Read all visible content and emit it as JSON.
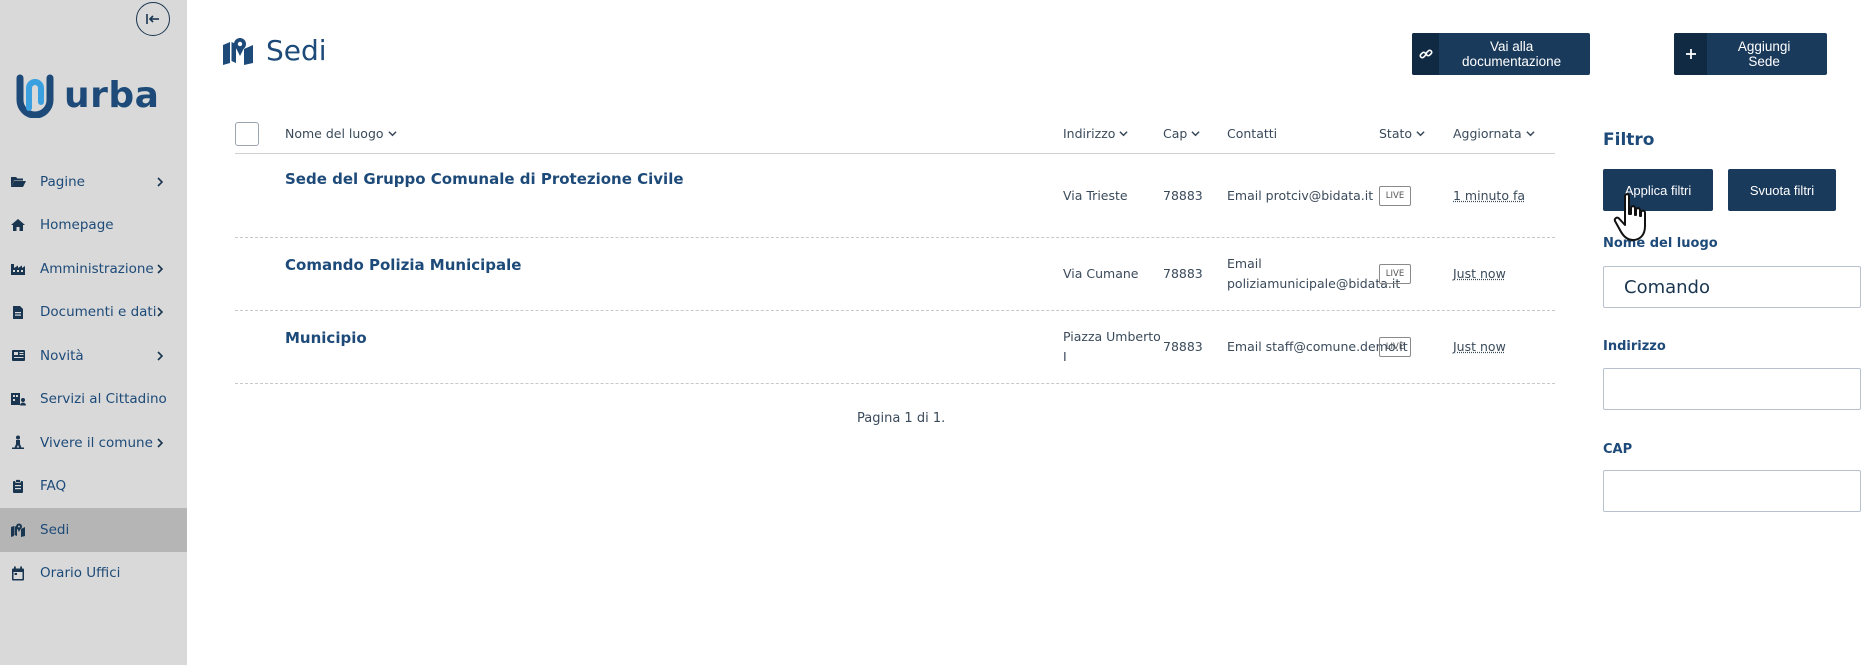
{
  "app": {
    "logo_text": "urba",
    "brand_color": "#1d4a78",
    "sidebar_color": "#d9d9d9",
    "active_item_color": "#b5b5b5",
    "button_color": "#1a3a5c"
  },
  "sidebar": {
    "items": [
      {
        "label": "Pagine",
        "icon": "folder-open-icon",
        "has_submenu": true
      },
      {
        "label": "Homepage",
        "icon": "home-icon",
        "has_submenu": false
      },
      {
        "label": "Amministrazione",
        "icon": "industry-icon",
        "has_submenu": true
      },
      {
        "label": "Documenti e dati",
        "icon": "file-icon",
        "has_submenu": true
      },
      {
        "label": "Novità",
        "icon": "newspaper-icon",
        "has_submenu": true
      },
      {
        "label": "Servizi al Cittadino",
        "icon": "building-user-icon",
        "has_submenu": false
      },
      {
        "label": "Vivere il comune",
        "icon": "person-hiking-icon",
        "has_submenu": true
      },
      {
        "label": "FAQ",
        "icon": "clipboard-icon",
        "has_submenu": false
      },
      {
        "label": "Sedi",
        "icon": "map-location-icon",
        "has_submenu": false,
        "active": true
      },
      {
        "label": "Orario Uffici",
        "icon": "calendar-icon",
        "has_submenu": false
      }
    ]
  },
  "header": {
    "title": "Sedi",
    "docs_button": "Vai alla documentazione",
    "add_button": "Aggiungi Sede"
  },
  "table": {
    "columns": [
      "Nome del luogo",
      "Indirizzo",
      "Cap",
      "Contatti",
      "Stato",
      "Aggiornata"
    ],
    "rows": [
      {
        "name": "Sede del Gruppo Comunale di Protezione Civile",
        "address_1": "Via Trieste",
        "address_2": "",
        "cap": "78883",
        "contact_1": "Email protciv@bidata.it",
        "contact_2": "",
        "status": "LIVE",
        "updated": "1 minuto fa"
      },
      {
        "name": "Comando Polizia Municipale",
        "address_1": "Via Cumane",
        "address_2": "",
        "cap": "78883",
        "contact_1": "Email",
        "contact_2": "poliziamunicipale@bidata.it",
        "status": "LIVE",
        "updated": "Just now"
      },
      {
        "name": "Municipio",
        "address_1": "Piazza Umberto",
        "address_2": "I",
        "cap": "78883",
        "contact_1": "Email staff@comune.demo.it",
        "contact_2": "",
        "status": "LIVE",
        "updated": "Just now"
      }
    ]
  },
  "pager": {
    "text": "Pagina 1 di 1."
  },
  "filter": {
    "title": "Filtro",
    "apply_button": "Applica filtri",
    "clear_button": "Svuota filtri",
    "name_label": "Nome del luogo",
    "name_value": "Comando",
    "address_label": "Indirizzo",
    "address_value": "",
    "cap_label": "CAP",
    "cap_value": ""
  }
}
